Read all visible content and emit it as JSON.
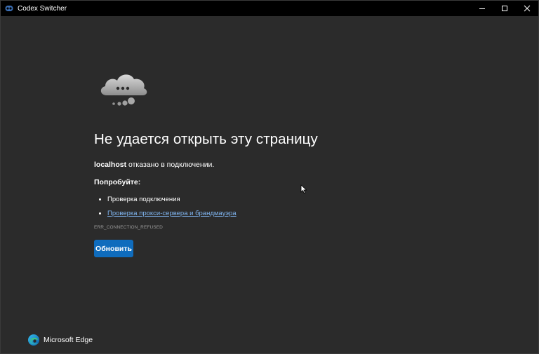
{
  "window": {
    "title": "Codex Switcher",
    "icon": "codex-app-icon",
    "controls": [
      "minimize-icon",
      "maximize-icon",
      "close-icon"
    ]
  },
  "error_page": {
    "illustration": "cloud-dots-icon",
    "heading": "Не удается открыть эту страницу",
    "host": "localhost",
    "message": "отказано в подключении.",
    "try_label": "Попробуйте:",
    "suggestions": [
      {
        "label": "Проверка подключения",
        "is_link": false
      },
      {
        "label": "Проверка прокси-сервера и брандмауэра",
        "is_link": true
      }
    ],
    "error_code": "ERR_CONNECTION_REFUSED",
    "reload_label": "Обновить"
  },
  "brand": {
    "name": "Microsoft Edge",
    "logo": "edge-logo-icon"
  },
  "colors": {
    "background": "#2b2b2b",
    "titlebar": "#000000",
    "accent": "#0f6cbd",
    "link": "#7fb4ef"
  }
}
